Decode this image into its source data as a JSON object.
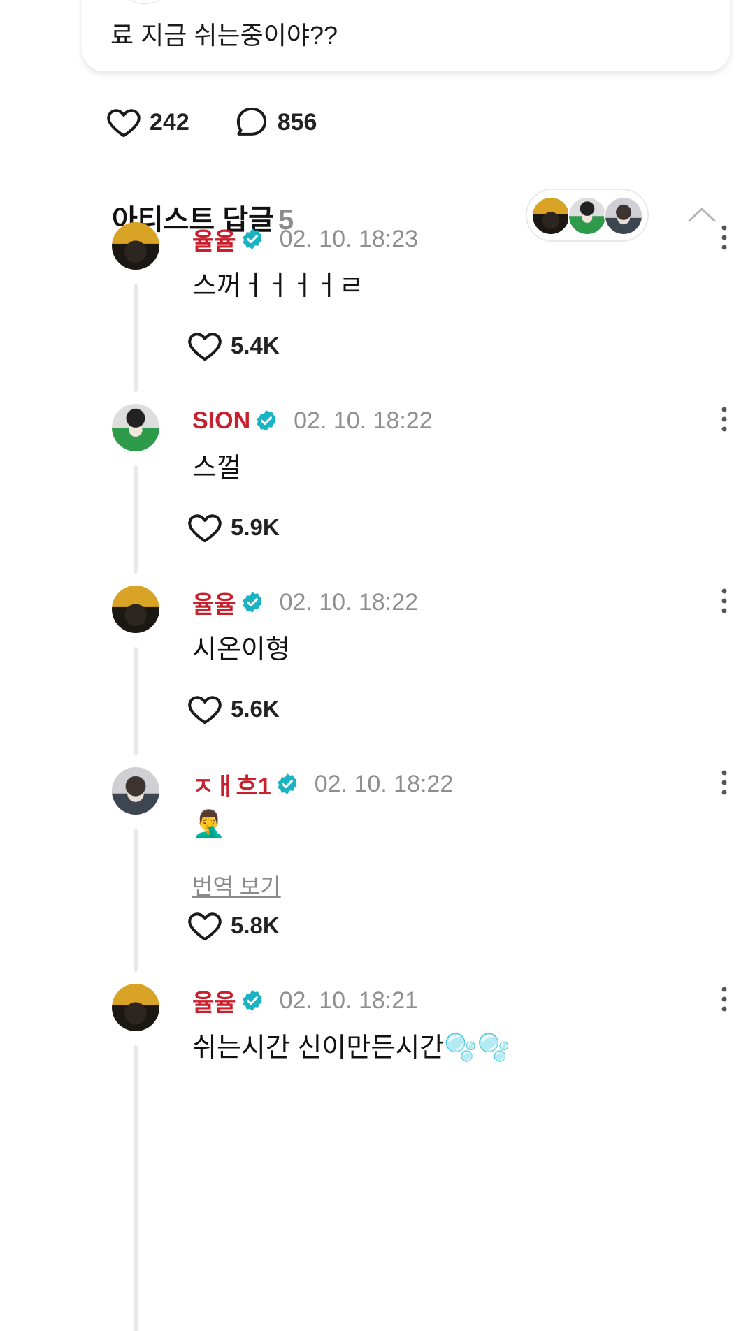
{
  "post": {
    "text": "료 지금 쉬는중이야??",
    "likes": "242",
    "comments": "856"
  },
  "artist_replies": {
    "title": "아티스트 답글",
    "count": "5",
    "avatars": [
      "율율",
      "SION",
      "ㅈㅐ흐1"
    ]
  },
  "replies": [
    {
      "name": "율율",
      "time": "02. 10. 18:23",
      "text": "스꺼ㅓㅓㅓㅓㄹ",
      "likes": "5.4K",
      "avatar": "yuly"
    },
    {
      "name": "SION",
      "time": "02. 10. 18:22",
      "text": "스껄",
      "likes": "5.9K",
      "avatar": "sion"
    },
    {
      "name": "율율",
      "time": "02. 10. 18:22",
      "text": "시온이형",
      "likes": "5.6K",
      "avatar": "yuly"
    },
    {
      "name": "ㅈㅐ흐1",
      "time": "02. 10. 18:22",
      "text": "🤦‍♂️",
      "translate": "번역 보기",
      "likes": "5.8K",
      "avatar": "jaehee"
    },
    {
      "name": "율율",
      "time": "02. 10. 18:21",
      "text": "쉬는시간 신이만든시간🫧🫧",
      "avatar": "yuly"
    }
  ],
  "colors": {
    "artist_name": "#c8202d",
    "verified_badge": "#1ab3c4",
    "timestamp": "#8e8e8e",
    "thread_line": "#e9e9e9"
  },
  "icons": [
    "heart-icon",
    "comment-bubble-icon",
    "verified-badge-icon",
    "more-vertical-icon",
    "chevron-up-icon"
  ]
}
